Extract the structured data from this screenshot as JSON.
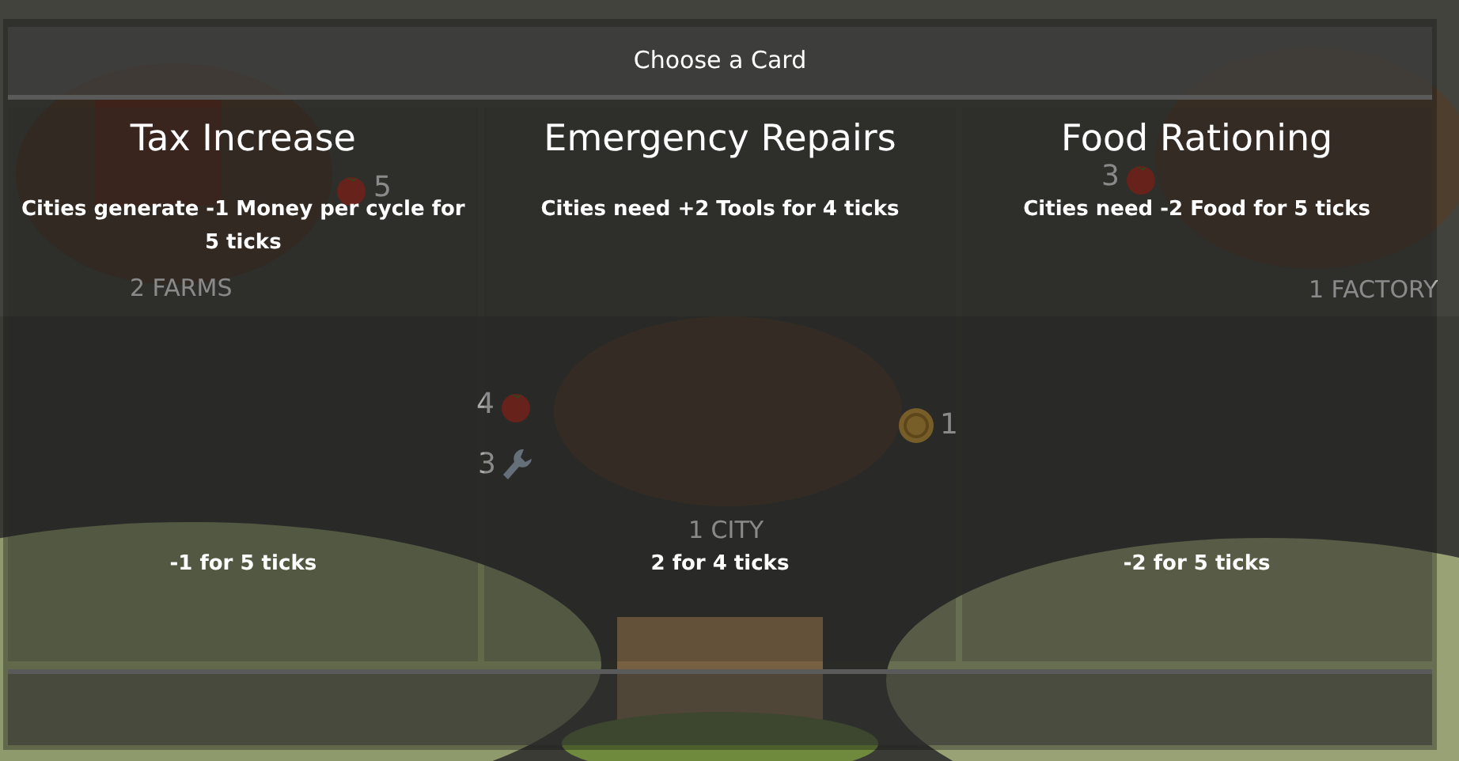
{
  "board": {
    "labels": [
      "2 FARMS",
      "1 CITY",
      "1 FACTORY"
    ],
    "resources": [
      {
        "kind": "food",
        "amount": "5"
      },
      {
        "kind": "food",
        "amount": "4"
      },
      {
        "kind": "tools",
        "amount": "3"
      },
      {
        "kind": "money",
        "amount": "1"
      },
      {
        "kind": "food",
        "amount": "3"
      }
    ]
  },
  "dialog": {
    "title": "Choose a Card",
    "cards": [
      {
        "title": "Tax Increase",
        "description": "Cities generate -1 Money per cycle for 5 ticks",
        "effect": "-1 for 5 ticks"
      },
      {
        "title": "Emergency Repairs",
        "description": "Cities need +2 Tools for 4 ticks",
        "effect": "2 for 4 ticks"
      },
      {
        "title": "Food Rationing",
        "description": "Cities need -2 Food for 5 ticks",
        "effect": "-2 for 5 ticks"
      }
    ]
  }
}
